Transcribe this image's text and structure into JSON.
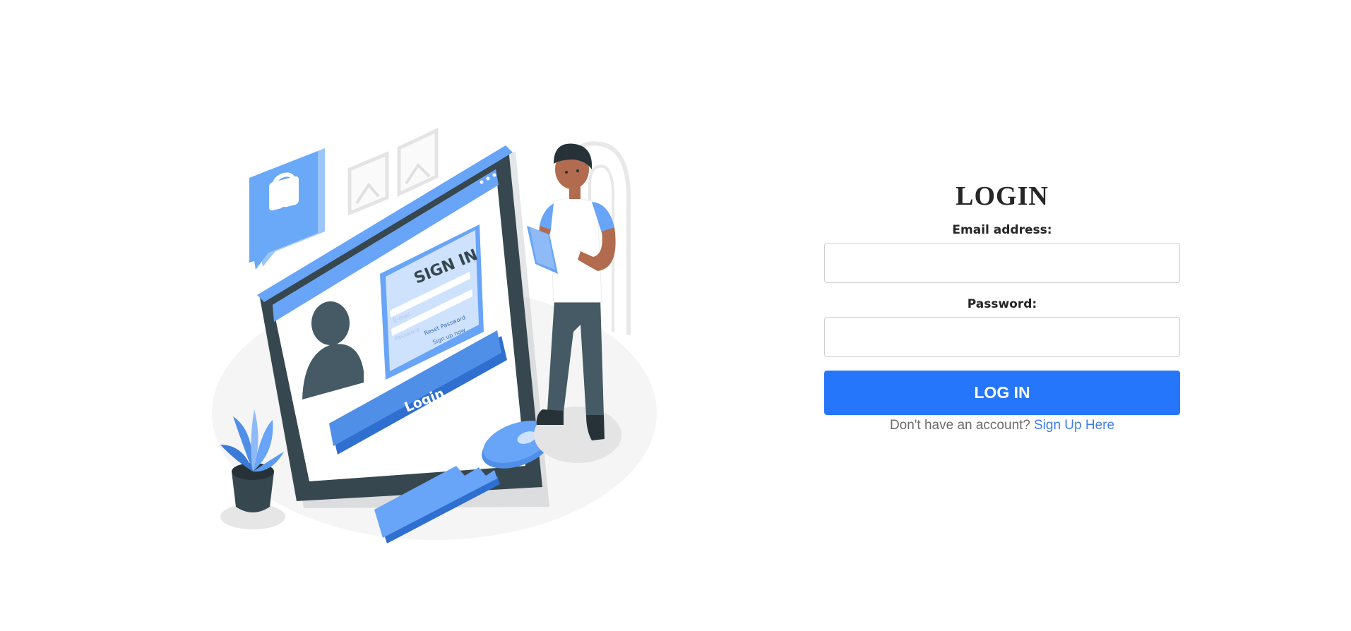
{
  "login": {
    "title": "LOGIN",
    "email_label": "Email address:",
    "email_value": "",
    "password_label": "Password:",
    "password_value": "",
    "submit_label": "LOG IN",
    "signup_prompt": "Don't have an account?",
    "signup_link": "Sign Up Here"
  },
  "illustration": {
    "signin_heading": "SIGN IN",
    "email_placeholder": "E-mail",
    "password_placeholder": "Password",
    "reset_link": "Reset Password",
    "signup_link": "Sign up now",
    "login_button": "Login"
  },
  "colors": {
    "accent": "#2676fb",
    "link": "#3d7cf0",
    "illustration_blue": "#68a4f7",
    "illustration_dark": "#37474f"
  }
}
